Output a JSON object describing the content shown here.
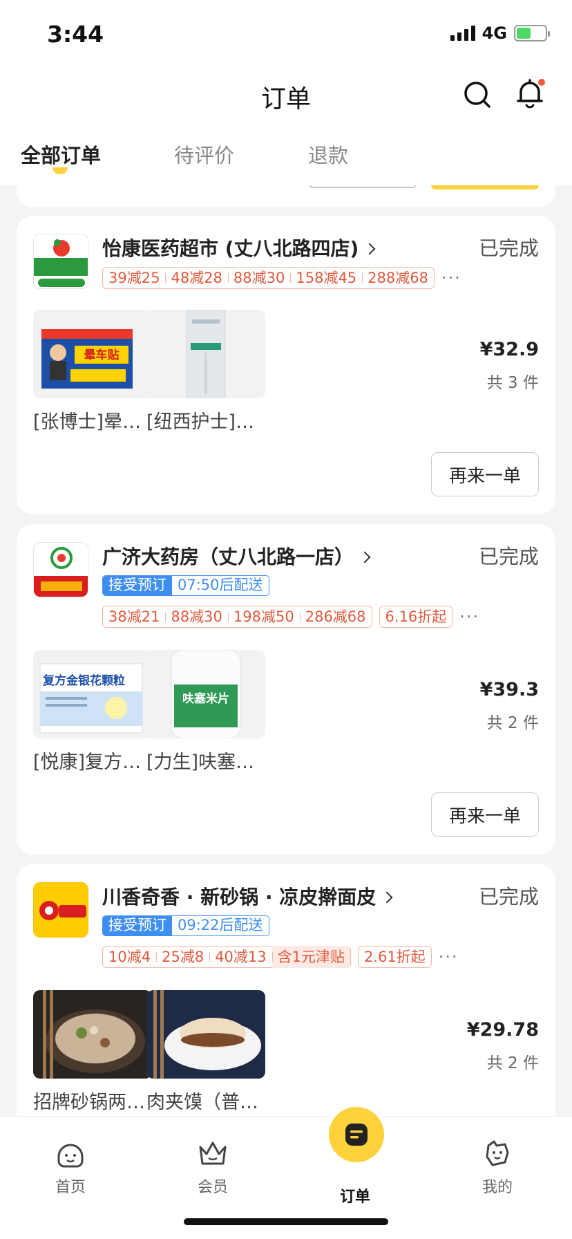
{
  "status_bar": {
    "time": "3:44",
    "network": "4G",
    "battery_level": 0.5
  },
  "header": {
    "title": "订单"
  },
  "tabs": [
    {
      "label": "全部订单"
    },
    {
      "label": "待评价"
    },
    {
      "label": "退款"
    }
  ],
  "orders": [
    {
      "store": "怡康医药超市 (丈八北路四店)",
      "status": "已完成",
      "promos": [
        "39减25",
        "48减28",
        "88减30",
        "158减45",
        "288减68"
      ],
      "more": "···",
      "items": [
        {
          "name": "[张博士]晕…",
          "thumb_text": "晕车贴"
        },
        {
          "name": "[纽西护士]…",
          "thumb_text": ""
        }
      ],
      "price": "¥32.9",
      "count": "共 3 件",
      "reorder": "再来一单"
    },
    {
      "store": "广济大药房（丈八北路一店）",
      "status": "已完成",
      "presale_tag": "接受预订",
      "presale_time": "07:50后配送",
      "promos": [
        "38减21",
        "88减30",
        "198减50",
        "286减68"
      ],
      "discount": "6.16折起",
      "more": "···",
      "items": [
        {
          "name": "[悦康]复方…",
          "thumb_text": "复方金银花颗粒"
        },
        {
          "name": "[力生]呋塞…",
          "thumb_text": "呋塞米片"
        }
      ],
      "price": "¥39.3",
      "count": "共 2 件",
      "reorder": "再来一单"
    },
    {
      "store": "川香奇香 · 新砂锅 · 凉皮擀面皮",
      "status": "已完成",
      "presale_tag": "接受预订",
      "presale_time": "09:22后配送",
      "promos": [
        "10减4",
        "25减8",
        "40减13"
      ],
      "subsidy": "含1元津贴",
      "discount": "2.61折起",
      "more": "···",
      "items": [
        {
          "name": "招牌砂锅两…"
        },
        {
          "name": "肉夹馍（普…"
        }
      ],
      "price": "¥29.78",
      "count": "共 2 件"
    }
  ],
  "tabbar": [
    {
      "label": "首页"
    },
    {
      "label": "会员"
    },
    {
      "label": "订单"
    },
    {
      "label": "我的"
    }
  ],
  "colors": {
    "accent": "#ffd23c",
    "promo": "#e05b3e",
    "presale": "#3d8ef0"
  }
}
